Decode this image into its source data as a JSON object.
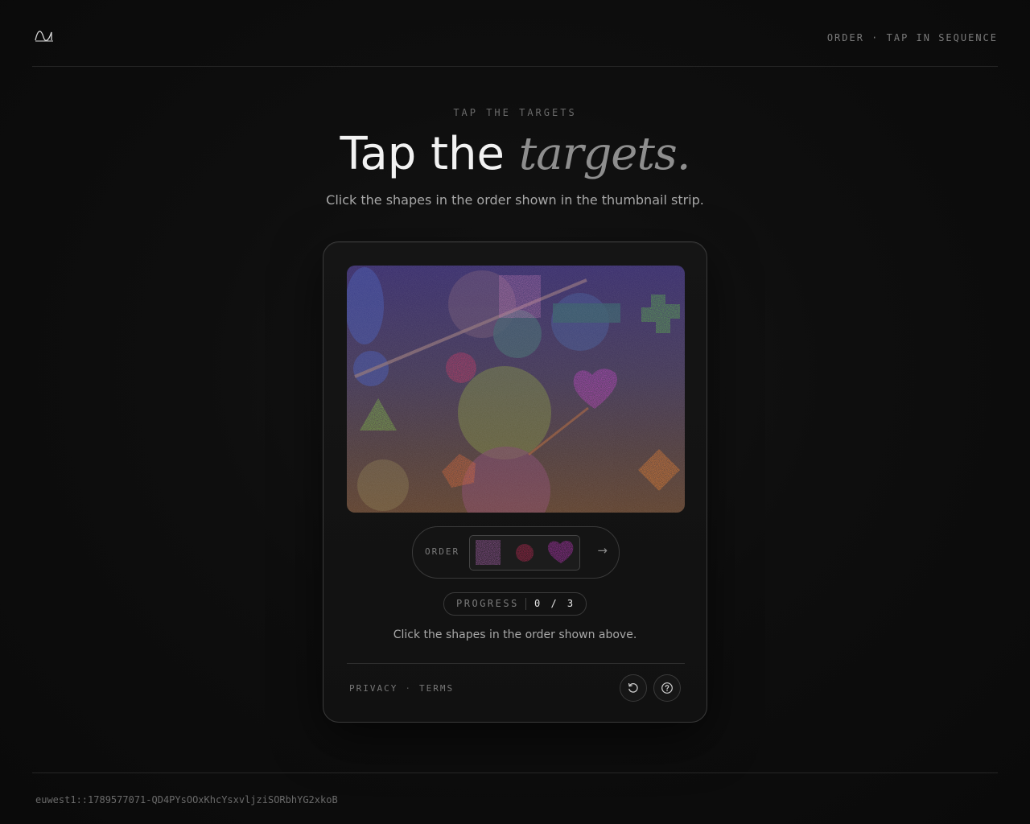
{
  "header": {
    "logo_icon": "wave-logo-icon",
    "mode_label": "ORDER · TAP IN SEQUENCE"
  },
  "hero": {
    "eyebrow": "TAP THE TARGETS",
    "title_plain": "Tap the ",
    "title_emphasis": "targets.",
    "subtitle": "Click the shapes in the order shown in the thumbnail strip."
  },
  "challenge": {
    "order_label": "ORDER",
    "order_sequence": [
      {
        "shape": "square",
        "color": "#b064b4"
      },
      {
        "shape": "circle",
        "color": "#d02a5a"
      },
      {
        "shape": "heart",
        "color": "#c837c8"
      }
    ],
    "arrow_icon": "arrow-right-icon",
    "progress_label": "PROGRESS",
    "progress_value": "0 / 3",
    "progress_done": 0,
    "progress_total": 3,
    "instruction": "Click the shapes in the order shown above."
  },
  "card_footer": {
    "privacy_label": "PRIVACY",
    "separator": "·",
    "terms_label": "TERMS",
    "refresh_icon": "refresh-icon",
    "help_icon": "help-icon"
  },
  "footer": {
    "session_id": "euwest1::1789577071-QD4PYsOOxKhcYsxvljziSORbhYG2xkoB"
  },
  "colors": {
    "background": "#0b0b0b",
    "card_border": "#3a3a3a",
    "text_primary": "#f2f2f2",
    "text_muted": "#7a7a7a",
    "canvas_top": "#3a2a6e",
    "canvas_bottom": "#5a3a28"
  }
}
